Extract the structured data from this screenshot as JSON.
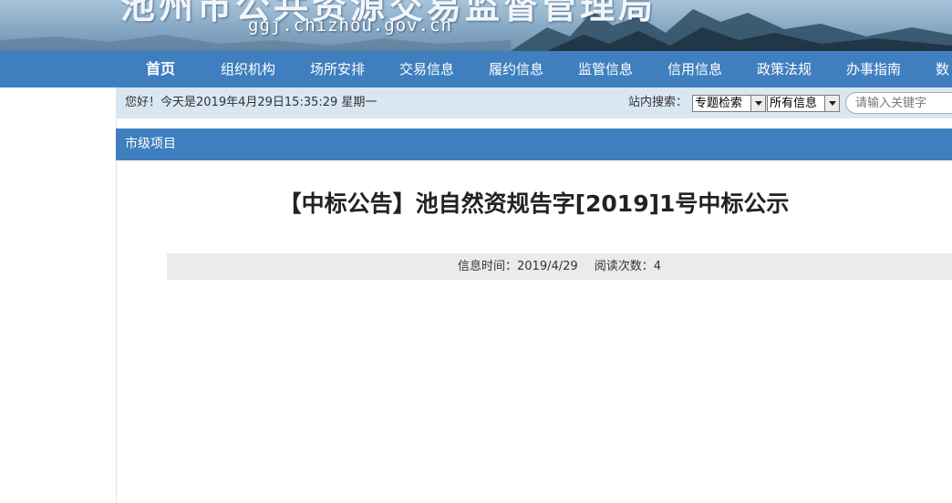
{
  "header": {
    "site_title": "池州市公共资源交易监督管理局",
    "site_domain": "ggj.chizhou.gov.cn"
  },
  "nav": {
    "items": [
      {
        "label": "首页",
        "active": true
      },
      {
        "label": "组织机构"
      },
      {
        "label": "场所安排"
      },
      {
        "label": "交易信息"
      },
      {
        "label": "履约信息"
      },
      {
        "label": "监管信息"
      },
      {
        "label": "信用信息"
      },
      {
        "label": "政策法规"
      },
      {
        "label": "办事指南"
      },
      {
        "label": "数"
      }
    ]
  },
  "infobar": {
    "greeting": "您好！今天是2019年4月29日15:35:29 星期一",
    "search_label": "站内搜索：",
    "topic_select": "专题检索",
    "scope_select": "所有信息",
    "search_placeholder": "请输入关键字"
  },
  "section": {
    "title": "市级项目"
  },
  "article": {
    "title": "【中标公告】池自然资规告字[2019]1号中标公示",
    "time_label": "信息时间：",
    "time_value": "2019/4/29",
    "views_label": "阅读次数：",
    "views_value": "4"
  },
  "colors": {
    "nav_blue": "#3f7fbf",
    "infobar_bg": "#d9e7f3",
    "meta_bg": "#ebebeb"
  }
}
